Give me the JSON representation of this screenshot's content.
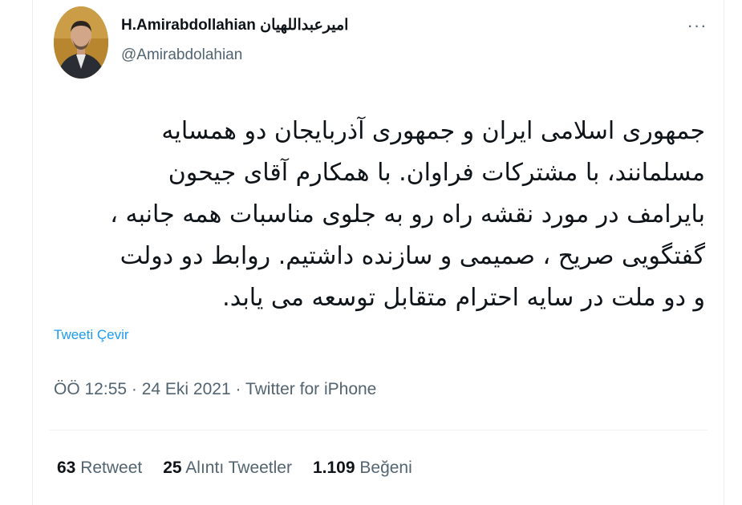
{
  "author": {
    "display_name": "H.Amirabdollahian امیرعبداللهیان",
    "handle": "@Amirabdolahian"
  },
  "menu": {
    "more_icon": "more-dots-icon",
    "more_label": "···"
  },
  "tweet": {
    "lines": [
      "جمهوری اسلامی ایران و جمهوری آذربایجان دو همسایه",
      "مسلمانند، با مشترکات فراوان. با همکارم آقای جیحون",
      "بایرامف در مورد نقشه راه رو به جلوی مناسبات همه جانبه ،",
      "گفتگویی صریح ، صمیمی و سازنده داشتیم. روابط دو دولت",
      "و دو ملت در سایه احترام متقابل توسعه می یابد."
    ],
    "translate_label": "Tweeti Çevir"
  },
  "meta": {
    "time": "ÖÖ 12:55",
    "sep1": " · ",
    "date": "24 Eki 2021",
    "sep2": " · ",
    "source": "Twitter for iPhone"
  },
  "stats": {
    "retweets_count": "63",
    "retweets_label": "Retweet",
    "quotes_count": "25",
    "quotes_label": "Alıntı Tweetler",
    "likes_count": "1.109",
    "likes_label": "Beğeni"
  },
  "colors": {
    "link": "#1d9bf0",
    "secondary_text": "#536471",
    "primary_text": "#0f1419"
  }
}
